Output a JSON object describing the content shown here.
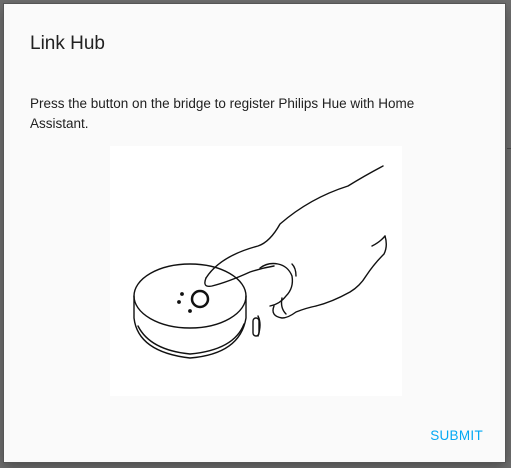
{
  "dialog": {
    "title": "Link Hub",
    "message": "Press the button on the bridge to register Philips Hue with Home Assistant.",
    "submit_label": "SUBMIT",
    "illustration_icon": "hand-pressing-hub-button-illustration"
  },
  "colors": {
    "accent": "#03a9f4",
    "dialog_background": "#fafafa",
    "backdrop": "#6e6e6e",
    "text": "#212121"
  }
}
